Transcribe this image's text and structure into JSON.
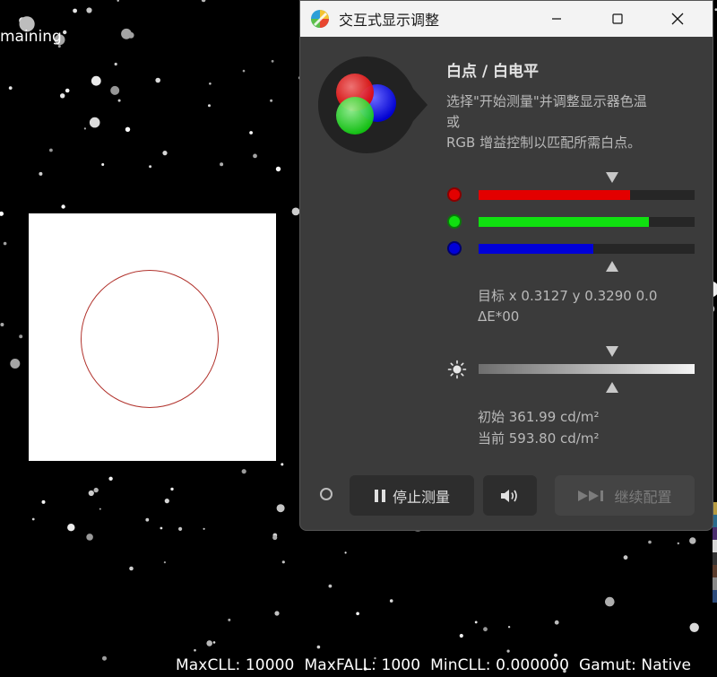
{
  "background": {
    "top_left_text": "maining",
    "status_bar": {
      "max_cll": "MaxCLL: 10000",
      "max_fall": "MaxFALL: 1000",
      "min_cll": "MinCLL: 0.000000",
      "gamut": "Gamut: Native"
    }
  },
  "window": {
    "title": "交互式显示调整",
    "controls": {
      "minimize": "minimize",
      "maximize": "maximize",
      "close": "close"
    }
  },
  "panel": {
    "heading": "白点 / 白电平",
    "description_lines": [
      "选择\"开始测量\"并调整显示器色温",
      "或",
      "RGB 增益控制以匹配所需白点。"
    ],
    "rgb_bars": [
      {
        "name": "red",
        "color": "#e30000",
        "level": 0.7
      },
      {
        "name": "green",
        "color": "#10e010",
        "level": 0.79
      },
      {
        "name": "blue",
        "color": "#0000d8",
        "level": 0.53
      }
    ],
    "target_text": "目标 x 0.3127 y 0.3290 0.0 ΔE*00",
    "luminance": {
      "initial": "初始 361.99 cd/m²",
      "current": "当前 593.80 cd/m²"
    }
  },
  "buttons": {
    "stop": "停止测量",
    "continue": "继续配置"
  },
  "icons": {
    "app": "color-wheel-icon",
    "sun": "sun-icon",
    "pause": "pause-icon",
    "speaker": "speaker-icon",
    "skip": "skip-forward-icon"
  },
  "colors": {
    "window_bg": "#3b3b3b",
    "patch_ring": "#b1322c",
    "button_bg": "#2d2d2d"
  }
}
